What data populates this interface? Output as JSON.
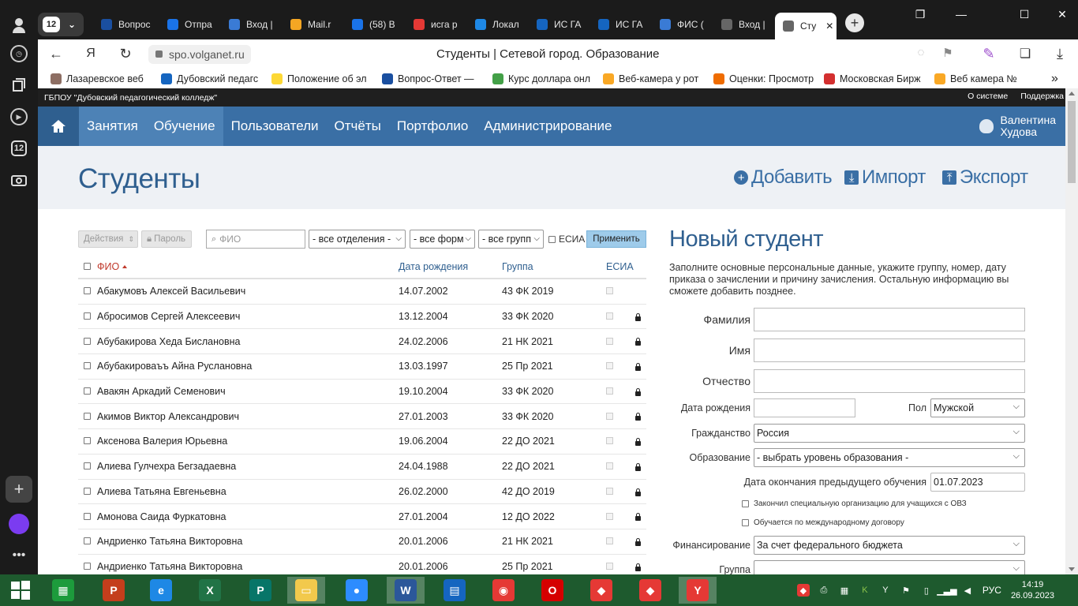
{
  "browser": {
    "tab_group_count": "12",
    "tabs": [
      {
        "label": "Вопрос",
        "color": "#1a4fa0"
      },
      {
        "label": "Отпра",
        "color": "#1a73e8"
      },
      {
        "label": "Вход |",
        "color": "#3a7bd5"
      },
      {
        "label": "Mail.r",
        "color": "#f5a623"
      },
      {
        "label": "(58) В",
        "color": "#1a73e8"
      },
      {
        "label": "исга р",
        "color": "#e53935"
      },
      {
        "label": "Локал",
        "color": "#1e88e5"
      },
      {
        "label": "ИС ГА",
        "color": "#1565c0"
      },
      {
        "label": "ИС ГА",
        "color": "#1565c0"
      },
      {
        "label": "ФИС (",
        "color": "#3a7bd5"
      },
      {
        "label": "Вход |",
        "color": "#666666"
      },
      {
        "label": "Сту",
        "color": "#666666",
        "active": true
      }
    ],
    "url": "spo.volganet.ru",
    "page_title": "Студенты | Сетевой город. Образование",
    "bookmarks": [
      {
        "label": "Лазаревское веб",
        "color": "#8d6e63"
      },
      {
        "label": "Дубовский педагс",
        "color": "#1565c0"
      },
      {
        "label": "Положение об эл",
        "color": "#fdd835"
      },
      {
        "label": "Вопрос-Ответ — ",
        "color": "#1a4fa0"
      },
      {
        "label": "Курс доллара онл",
        "color": "#43a047"
      },
      {
        "label": "Веб-камера у рот",
        "color": "#f9a825"
      },
      {
        "label": "Оценки: Просмотр",
        "color": "#ef6c00"
      },
      {
        "label": "Московская Бирж",
        "color": "#d32f2f"
      },
      {
        "label": "Веб камера №",
        "color": "#f9a825"
      }
    ]
  },
  "site": {
    "org": "ГБПОУ \"Дубовский педагогический колледж\"",
    "top_links": [
      "О системе",
      "Поддержка"
    ],
    "nav": [
      "Занятия",
      "Обучение",
      "Пользователи",
      "Отчёты",
      "Портфолио",
      "Администрирование"
    ],
    "user_line1": "Валентина",
    "user_line2": "Худова"
  },
  "header": {
    "title": "Студенты",
    "add": "Добавить",
    "import": "Импорт",
    "export": "Экспорт"
  },
  "toolbar": {
    "actions": "Действия",
    "password": "Пароль",
    "search_placeholder": "ФИО",
    "dept": "- все отделения -",
    "form": "- все форм",
    "group": "- все групп",
    "esia": "ЕСИА",
    "apply": "Применить"
  },
  "table": {
    "headers": {
      "fio": "ФИО",
      "dob": "Дата рождения",
      "group": "Группа",
      "esia": "ЕСИА"
    },
    "rows": [
      {
        "fio": "Абакумовъ Алексей Васильевич",
        "dob": "14.07.2002",
        "group": "43 ФК 2019",
        "lock": false
      },
      {
        "fio": "Абросимов Сергей Алексеевич",
        "dob": "13.12.2004",
        "group": "33 ФК 2020",
        "lock": true
      },
      {
        "fio": "Абубакирова Хеда Бислановна",
        "dob": "24.02.2006",
        "group": "21 НК 2021",
        "lock": true
      },
      {
        "fio": "Абубакироваъъ Айна Руслановна",
        "dob": "13.03.1997",
        "group": "25 Пр 2021",
        "lock": true
      },
      {
        "fio": "Авакян Аркадий Семенович",
        "dob": "19.10.2004",
        "group": "33 ФК 2020",
        "lock": true
      },
      {
        "fio": "Акимов Виктор Александрович",
        "dob": "27.01.2003",
        "group": "33 ФК 2020",
        "lock": true
      },
      {
        "fio": "Аксенова Валерия Юрьевна",
        "dob": "19.06.2004",
        "group": "22 ДО 2021",
        "lock": true
      },
      {
        "fio": "Алиева Гулчехра Бегзадаевна",
        "dob": "24.04.1988",
        "group": "22 ДО 2021",
        "lock": true
      },
      {
        "fio": "Алиева Татьяна Евгеньевна",
        "dob": "26.02.2000",
        "group": "42 ДО 2019",
        "lock": true
      },
      {
        "fio": "Амонова Саида Фуркатовна",
        "dob": "27.01.2004",
        "group": "12 ДО 2022",
        "lock": true
      },
      {
        "fio": "Андриенко Татьяна Викторовна",
        "dob": "20.01.2006",
        "group": "21 НК 2021",
        "lock": true
      },
      {
        "fio": "Андриенко Татьяна Викторовна",
        "dob": "20.01.2006",
        "group": "25 Пр 2021",
        "lock": true
      }
    ]
  },
  "form": {
    "title": "Новый студент",
    "description": "Заполните основные персональные данные, укажите группу, номер, дату приказа о зачислении и причину зачисления. Остальную информацию вы сможете добавить позднее.",
    "surname": "Фамилия",
    "name": "Имя",
    "patronymic": "Отчество",
    "dob": "Дата рождения",
    "gender_label": "Пол",
    "gender_value": "Мужской",
    "citizenship_label": "Гражданство",
    "citizenship_value": "Россия",
    "education_label": "Образование",
    "education_value": "- выбрать уровень образования -",
    "prev_end_label": "Дата окончания предыдущего обучения",
    "prev_end_value": "01.07.2023",
    "ovz": "Закончил специальную организацию для учащихся с ОВЗ",
    "intl": "Обучается по международному договору",
    "finance_label": "Финансирование",
    "finance_value": "За счет федерального бюджета",
    "group_label": "Группа"
  },
  "taskbar": {
    "apps": [
      {
        "name": "excel-green",
        "color": "#1d9b3c",
        "glyph": "▦"
      },
      {
        "name": "powerpoint",
        "color": "#c43e1c",
        "glyph": "P"
      },
      {
        "name": "internet-explorer",
        "color": "#1e88e5",
        "glyph": "e"
      },
      {
        "name": "excel",
        "color": "#217346",
        "glyph": "X"
      },
      {
        "name": "publisher",
        "color": "#077568",
        "glyph": "P"
      },
      {
        "name": "file-explorer",
        "color": "#f2c94c",
        "glyph": "▭"
      },
      {
        "name": "zoom",
        "color": "#2d8cff",
        "glyph": "●"
      },
      {
        "name": "word",
        "color": "#2b579a",
        "glyph": "W"
      },
      {
        "name": "scanner",
        "color": "#1565c0",
        "glyph": "▤"
      },
      {
        "name": "chrome",
        "color": "#e53935",
        "glyph": "◉"
      },
      {
        "name": "opera",
        "color": "#d50000",
        "glyph": "O"
      },
      {
        "name": "anydesk",
        "color": "#e53935",
        "glyph": "◆"
      },
      {
        "name": "anydesk-2",
        "color": "#e53935",
        "glyph": "◆"
      },
      {
        "name": "yandex-browser",
        "color": "#e53935",
        "glyph": "Y"
      }
    ],
    "lang": "РУС",
    "time": "14:19",
    "date": "26.09.2023"
  }
}
